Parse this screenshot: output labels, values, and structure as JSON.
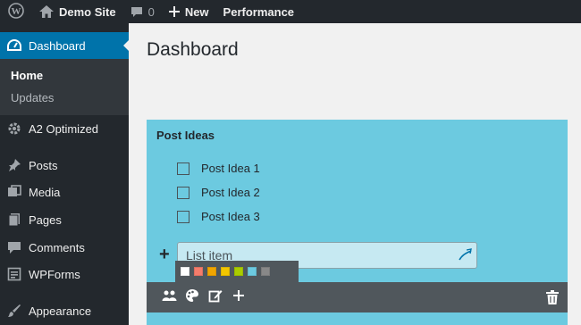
{
  "adminbar": {
    "site_name": "Demo Site",
    "comments_count": "0",
    "new_label": "New",
    "performance_label": "Performance"
  },
  "sidebar": {
    "dashboard_label": "Dashboard",
    "submenu": [
      "Home",
      "Updates"
    ],
    "items": [
      "A2 Optimized",
      "Posts",
      "Media",
      "Pages",
      "Comments",
      "WPForms",
      "Appearance"
    ]
  },
  "main": {
    "page_title": "Dashboard"
  },
  "widget": {
    "title": "Post Ideas",
    "items": [
      "Post Idea 1",
      "Post Idea 2",
      "Post Idea 3"
    ],
    "input_placeholder": "List item",
    "add_symbol": "+",
    "palette": [
      "#ffffff",
      "#f47c6b",
      "#f0a500",
      "#f2c600",
      "#aacc00",
      "#6ccae0",
      "#888888"
    ],
    "background_color": "#6ccae0"
  },
  "colors": {
    "adminbar_bg": "#23282d",
    "active_menu_bg": "#0073aa",
    "toolbar_bg": "#50575c"
  }
}
